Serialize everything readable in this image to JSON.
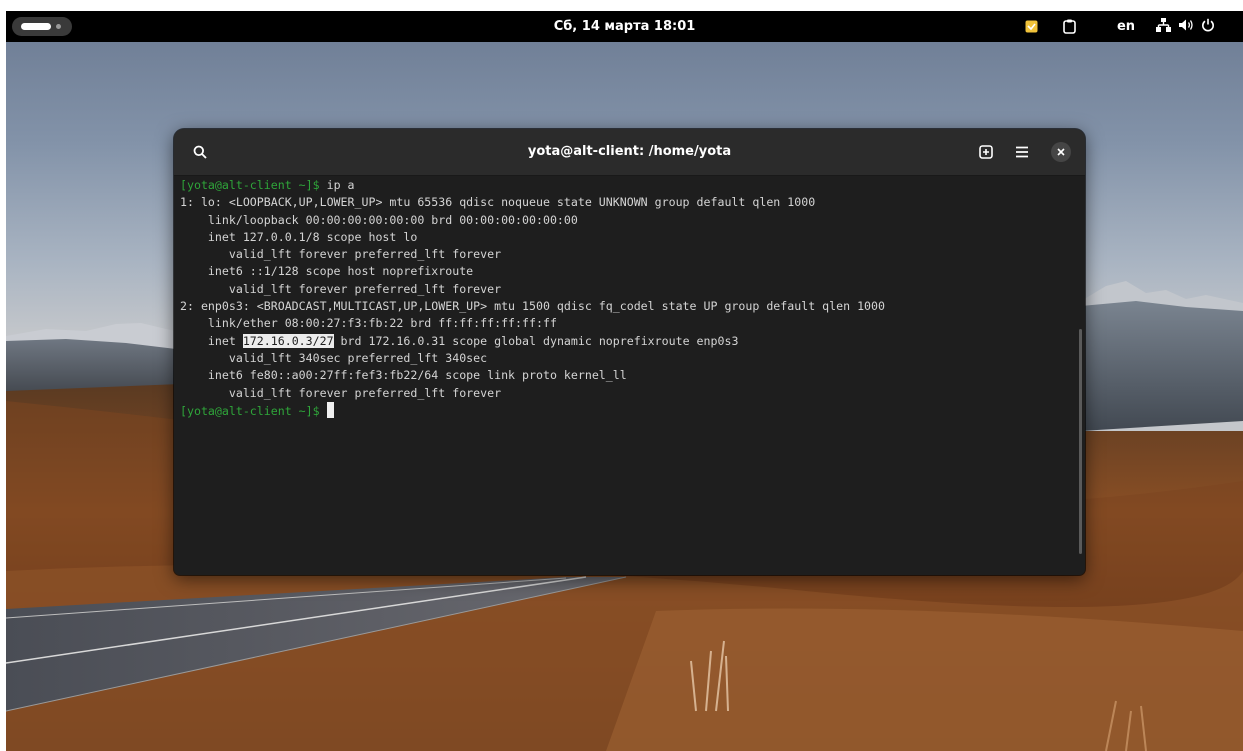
{
  "topbar": {
    "clock": "Сб, 14 марта  18:01",
    "language": "en",
    "icons": [
      "activities-indicator",
      "app-indicator-icon",
      "clipboard-icon",
      "network-wired-icon",
      "volume-icon",
      "power-icon"
    ]
  },
  "terminal": {
    "title": "yota@alt-client: /home/yota",
    "header_icons": [
      "search-icon",
      "new-tab-icon",
      "hamburger-menu-icon",
      "close-icon"
    ],
    "lines": [
      {
        "prompt": "[yota@alt-client ~]$ ",
        "text": "ip a"
      },
      {
        "text": "1: lo: <LOOPBACK,UP,LOWER_UP> mtu 65536 qdisc noqueue state UNKNOWN group default qlen 1000"
      },
      {
        "text": "    link/loopback 00:00:00:00:00:00 brd 00:00:00:00:00:00"
      },
      {
        "text": "    inet 127.0.0.1/8 scope host lo"
      },
      {
        "text": "       valid_lft forever preferred_lft forever"
      },
      {
        "text": "    inet6 ::1/128 scope host noprefixroute"
      },
      {
        "text": "       valid_lft forever preferred_lft forever"
      },
      {
        "text": "2: enp0s3: <BROADCAST,MULTICAST,UP,LOWER_UP> mtu 1500 qdisc fq_codel state UP group default qlen 1000"
      },
      {
        "text": "    link/ether 08:00:27:f3:fb:22 brd ff:ff:ff:ff:ff:ff"
      },
      {
        "text": "    inet ",
        "highlight": "172.16.0.3/27",
        "text_after": " brd 172.16.0.31 scope global dynamic noprefixroute enp0s3"
      },
      {
        "text": "       valid_lft 340sec preferred_lft 340sec"
      },
      {
        "text": "    inet6 fe80::a00:27ff:fef3:fb22/64 scope link proto kernel_ll"
      },
      {
        "text": "       valid_lft forever preferred_lft forever"
      },
      {
        "prompt": "[yota@alt-client ~]$ ",
        "text": "",
        "cursor": true
      }
    ]
  },
  "colors": {
    "prompt": "#2fa53a",
    "terminal_bg": "#1e1e1e",
    "headerbar_bg": "#2b2b2b",
    "topbar_bg": "#000000"
  }
}
